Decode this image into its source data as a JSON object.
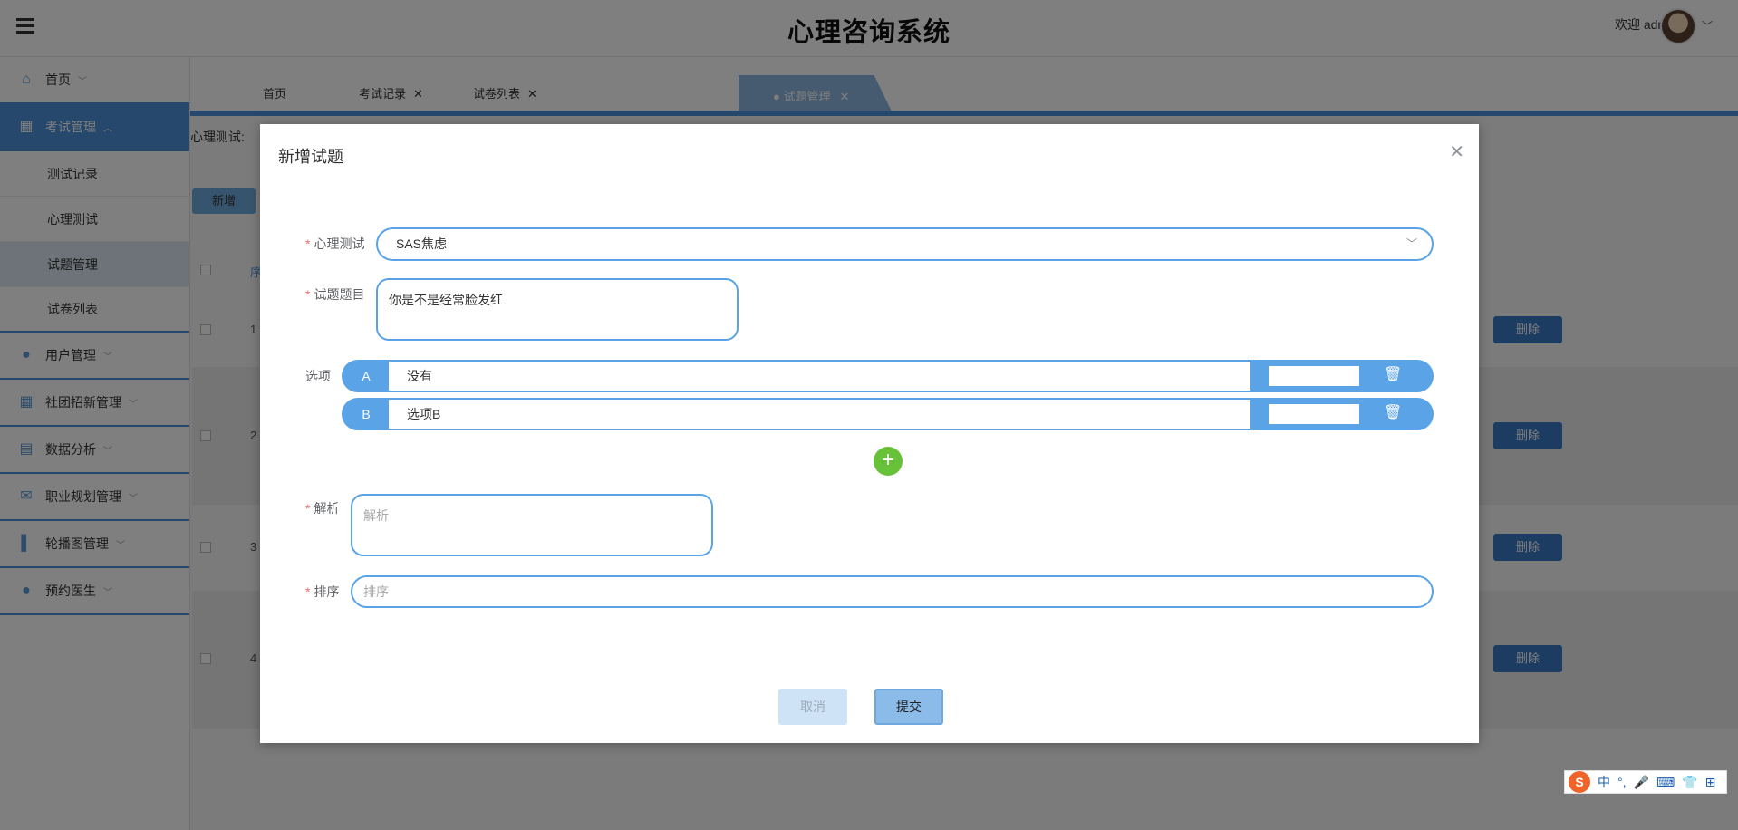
{
  "app": {
    "title": "心理咨询系统",
    "welcome": "欢迎 admin"
  },
  "sidebar": {
    "items": [
      {
        "label": "首页",
        "icon": "home-icon"
      },
      {
        "label": "考试管理",
        "icon": "grid-icon",
        "expanded": true,
        "children": [
          "测试记录",
          "心理测试",
          "试题管理",
          "试卷列表"
        ],
        "active_child": "试题管理"
      },
      {
        "label": "用户管理",
        "icon": "user-icon"
      },
      {
        "label": "社团招新管理",
        "icon": "grid-icon"
      },
      {
        "label": "数据分析",
        "icon": "chart-icon"
      },
      {
        "label": "职业规划管理",
        "icon": "mail-icon"
      },
      {
        "label": "轮播图管理",
        "icon": "panel-icon"
      },
      {
        "label": "预约医生",
        "icon": "user-icon"
      }
    ]
  },
  "tabs": [
    {
      "label": "首页",
      "closable": false
    },
    {
      "label": "考试记录",
      "closable": true
    },
    {
      "label": "试卷列表",
      "closable": true
    },
    {
      "label": "● 试题管理",
      "closable": true,
      "active": true
    }
  ],
  "page": {
    "filter_label": "心理测试:",
    "add_label": "新增",
    "table_header_partial": "序",
    "rows": [
      "1",
      "2",
      "3",
      "4"
    ],
    "delete_label": "删除"
  },
  "modal": {
    "title": "新增试题",
    "fields": {
      "test": {
        "label": "心理测试",
        "value": "SAS焦虑"
      },
      "question": {
        "label": "试题题目",
        "value": "你是不是经常脸发红"
      },
      "options_label": "选项",
      "options": [
        {
          "key": "A",
          "value": "没有",
          "placeholder": ""
        },
        {
          "key": "B",
          "value": "",
          "placeholder": "选项B"
        }
      ],
      "analysis": {
        "label": "解析",
        "placeholder": "解析"
      },
      "sort": {
        "label": "排序",
        "placeholder": "排序"
      }
    },
    "cancel_label": "取消",
    "submit_label": "提交"
  },
  "ime": {
    "logo": "S",
    "lang": "中",
    "items": [
      "°,",
      "🎤",
      "⌨",
      "👕",
      "⊞"
    ]
  },
  "colors": {
    "primary": "#4a90d9",
    "field_border": "#5aa3e6",
    "add_green": "#67c23a",
    "required": "#f56c6c"
  }
}
